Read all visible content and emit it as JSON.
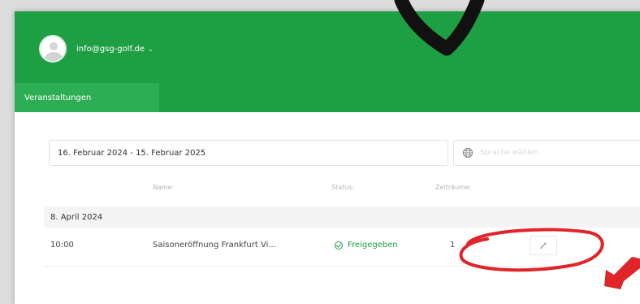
{
  "header": {
    "user_email": "info@gsg-golf.de",
    "user_chevron": "⌄"
  },
  "tabs": [
    {
      "label": "Veranstaltungen",
      "active": true
    }
  ],
  "filters": {
    "date_range": "16. Februar 2024 - 15. Februar 2025",
    "language_placeholder": "Sprache wählen",
    "language_chevron": "⌄"
  },
  "table": {
    "columns": [
      "Name:",
      "Status:",
      "Zeiträume:"
    ],
    "groups": [
      {
        "date": "8. April 2024",
        "rows": [
          {
            "time": "10:00",
            "name": "Saisoneröffnung Frankfurt Vi...",
            "status": "Freigegeben",
            "periods": "1",
            "action_icon": "edit-icon"
          }
        ]
      }
    ]
  },
  "annotations": {
    "arrow_color": "#111111",
    "circle_color": "#e0252a"
  },
  "colors": {
    "brand_green": "#1f9f43",
    "tab_green": "#2eae54"
  }
}
